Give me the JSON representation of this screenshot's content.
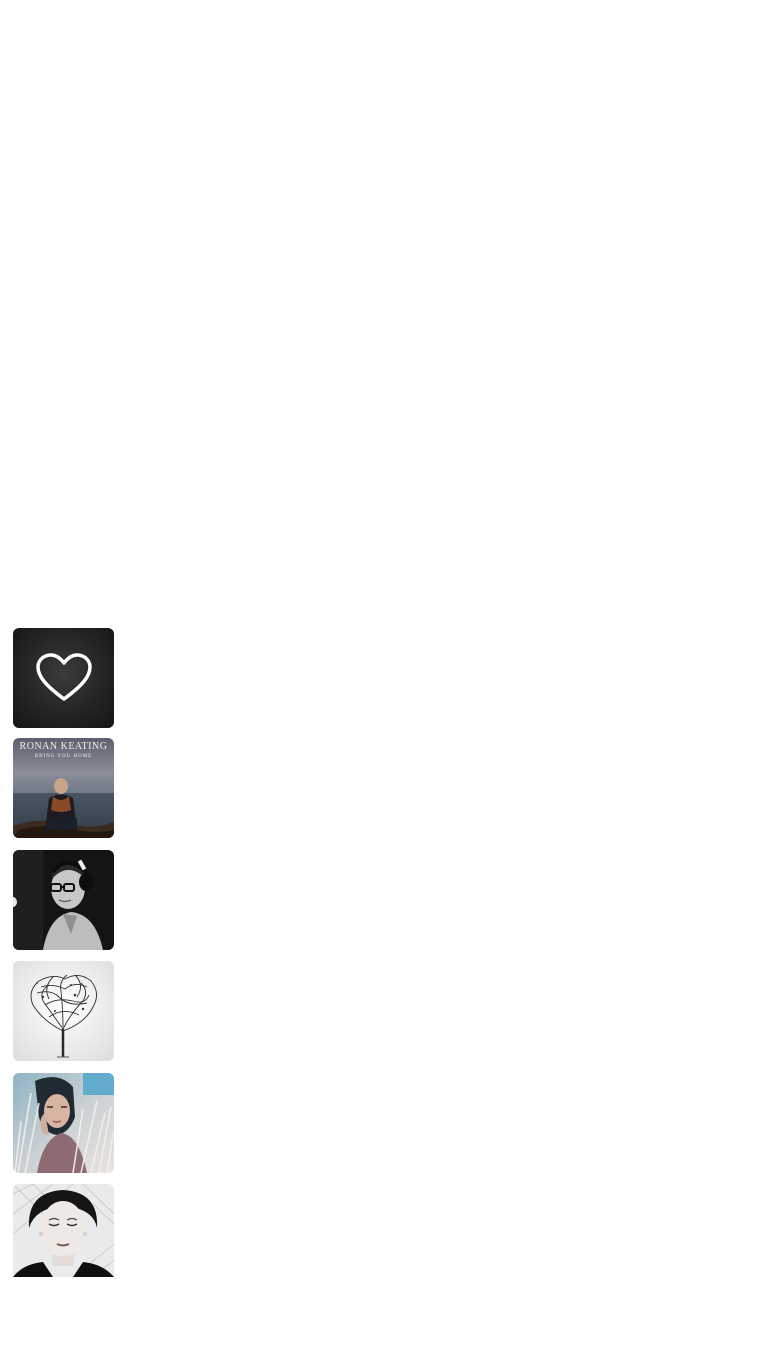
{
  "favorites": {
    "icon": "heart-icon",
    "colors": {
      "icon": "#ffffff",
      "tile": "#252525"
    }
  },
  "albums": [
    {
      "artist_text": "RONAN KEATING",
      "album_text": "BRING YOU HOME",
      "icon": "album-cover"
    },
    {
      "icon": "album-cover"
    },
    {
      "icon": "album-cover"
    },
    {
      "icon": "album-cover"
    },
    {
      "icon": "album-cover"
    }
  ]
}
